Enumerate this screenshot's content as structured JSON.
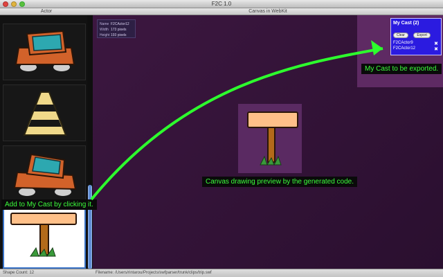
{
  "window": {
    "title": "F2C 1.0"
  },
  "left_panel": {
    "header": "Actor"
  },
  "right_panel": {
    "header": "Canvas in WebKit"
  },
  "info": {
    "name_label": "Name",
    "name_value": "F2CActor12",
    "width_label": "Width",
    "width_value": "173 pixels",
    "height_label": "Height",
    "height_value": "193 pixels"
  },
  "cast": {
    "title": "My Cast (2)",
    "clear_label": "Clear",
    "export_label": "Export",
    "items": [
      {
        "label": "F2CActor9"
      },
      {
        "label": "F2CActor12"
      }
    ]
  },
  "callouts": {
    "cast": "My Cast to be exported.",
    "preview": "Canvas drawing preview by the generated code.",
    "add": "Add to My Cast by clicking it."
  },
  "status": {
    "shape_count": "Shape Count: 12",
    "filename": "Filename: /Users/rintarou/Projects/swfparser/trunk/clips/trip.swf"
  },
  "colors": {
    "accent": "#2b1be0",
    "callout_text": "#3cff3c",
    "canvas_bg": "#3c1740",
    "selection_border": "#3a74c8"
  }
}
